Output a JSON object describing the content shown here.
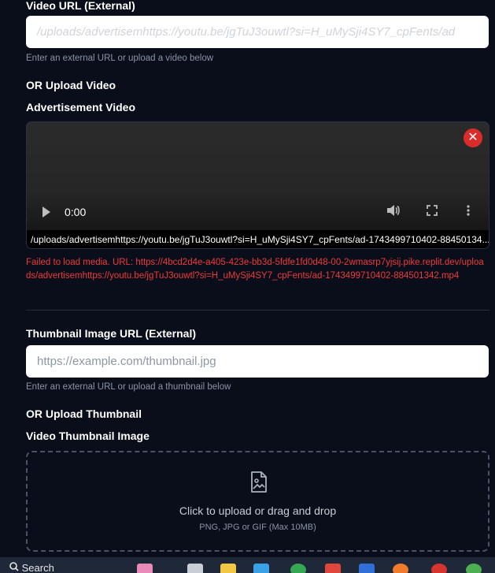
{
  "video_url": {
    "label": "Video URL (External)",
    "value": "/uploads/advertisemhttps://youtu.be/jgTuJ3ouwtl?si=H_uMySji4SY7_cpFents/ad",
    "help": "Enter an external URL or upload a video below"
  },
  "upload_video": {
    "or_label": "OR Upload Video",
    "label": "Advertisement Video",
    "time": "0:00",
    "url_text": "/uploads/advertisemhttps://youtu.be/jgTuJ3ouwtl?si=H_uMySji4SY7_cpFents/ad-1743499710402-88450134...",
    "remove_symbol": "✕",
    "error": "Failed to load media. URL: https://4bcd2d4e-a405-423e-bb3d-5fdfe1fd0d48-00-2wmasrp7yjsij.pike.replit.dev/uploads/advertisemhttps://youtu.be/jgTuJ3ouwtl?si=H_uMySji4SY7_cpFents/ad-1743499710402-884501342.mp4"
  },
  "thumbnail_url": {
    "label": "Thumbnail Image URL (External)",
    "placeholder": "https://example.com/thumbnail.jpg",
    "help": "Enter an external URL or upload a thumbnail below"
  },
  "upload_thumbnail": {
    "or_label": "OR Upload Thumbnail",
    "label": "Video Thumbnail Image",
    "dropzone_text": "Click to upload or drag and drop",
    "dropzone_hint": "PNG, JPG or GIF (Max 10MB)"
  },
  "taskbar": {
    "search_label": "Search"
  },
  "colors": {
    "background": "#0a0e1a",
    "error": "#ef3a3a",
    "remove_button": "#dc2b2b"
  }
}
